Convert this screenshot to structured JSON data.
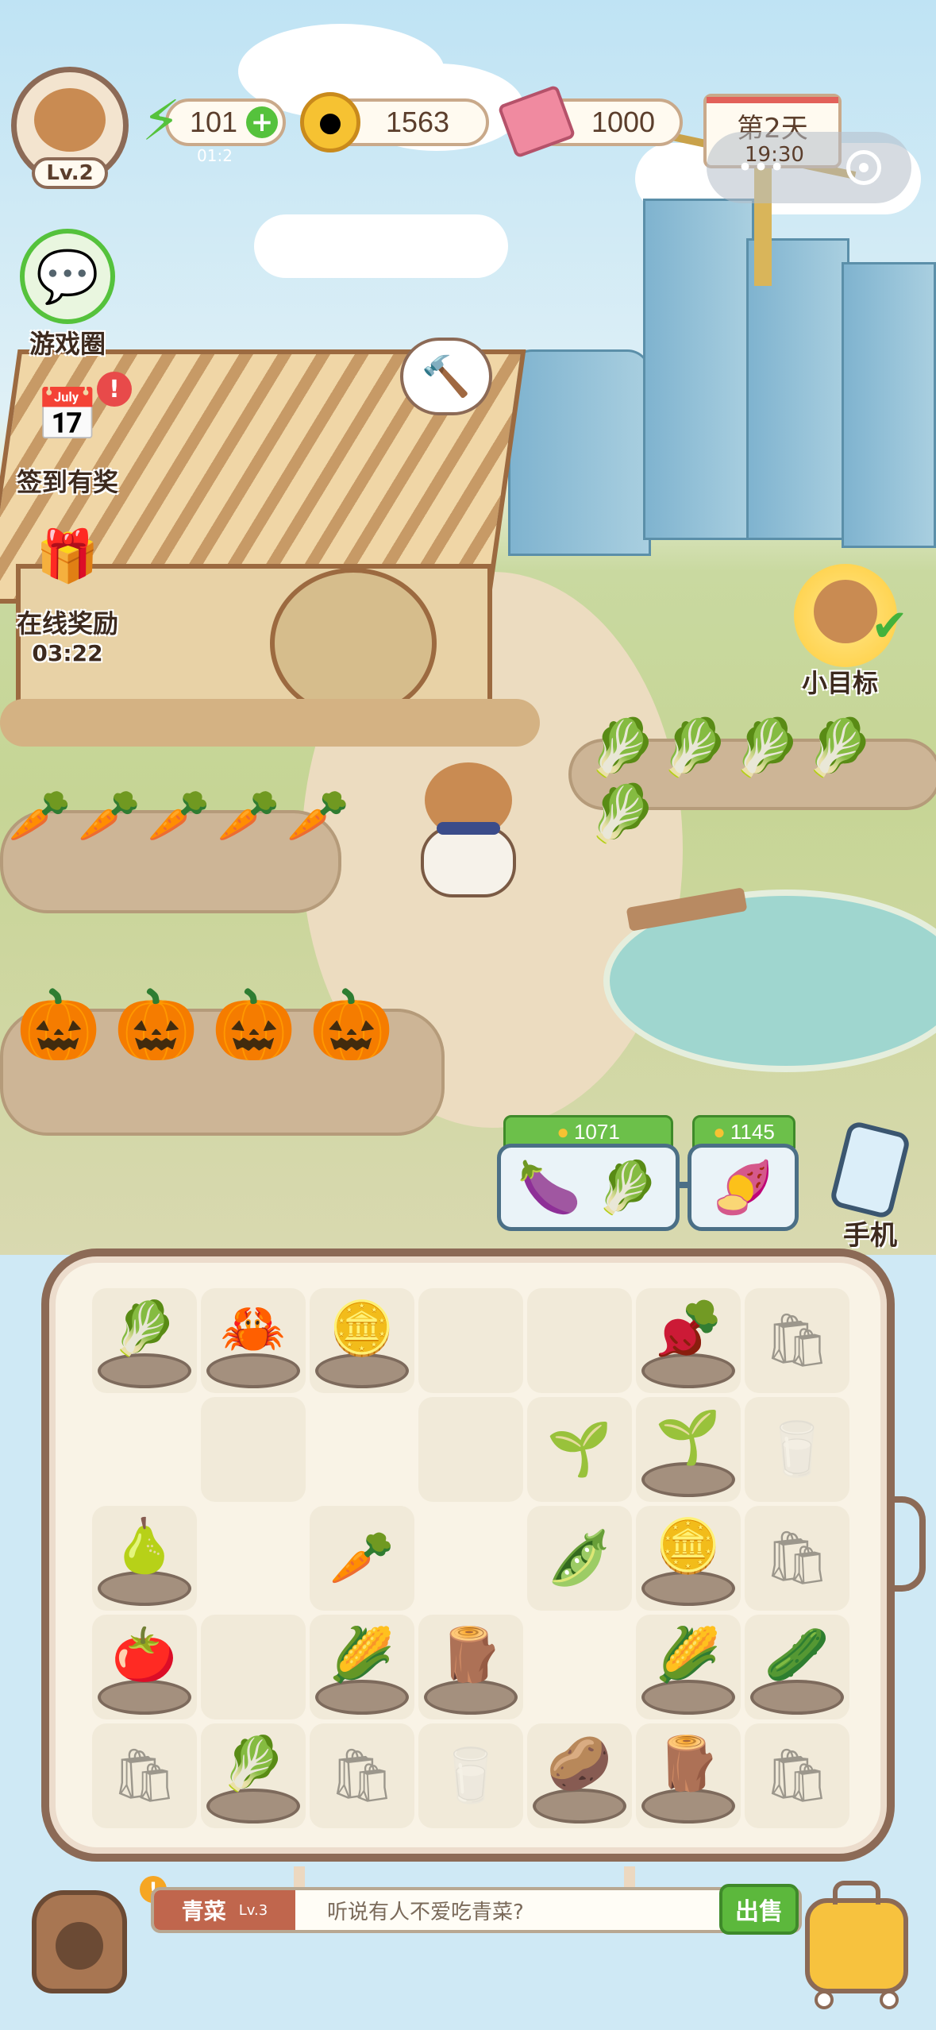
{
  "hud": {
    "level": "Lv.2",
    "energy": "101",
    "energy_timer": "01:2",
    "coins": "1563",
    "cash": "1000",
    "day": "第2天",
    "time": "19:30"
  },
  "side": {
    "game_circle": "游戏圈",
    "checkin": "签到有奖",
    "online_reward": "在线奖励",
    "online_timer": "03:22"
  },
  "goal": {
    "label": "小目标"
  },
  "orders": [
    {
      "price": "1071",
      "items": [
        "eggplant",
        "bok-choy"
      ]
    },
    {
      "price": "1145",
      "items": [
        "sweet-potato"
      ]
    }
  ],
  "phone": {
    "label": "手机"
  },
  "board": {
    "rows": [
      [
        "cabbage",
        "crab",
        "coin",
        "empty",
        "empty",
        "beet",
        "sack-ghost"
      ],
      [
        "none",
        "empty",
        "none",
        "empty",
        "sprout",
        "sprout-nest",
        "carton-ghost"
      ],
      [
        "gourd",
        "none",
        "carrot",
        "none",
        "pea",
        "coin",
        "sack-ghost"
      ],
      [
        "tomato",
        "empty",
        "corn",
        "yam",
        "none",
        "corn",
        "cucumber"
      ],
      [
        "sack-ghost",
        "napa",
        "sack-ghost",
        "carton-ghost",
        "potato",
        "yam",
        "sack-ghost"
      ]
    ],
    "glyphs": {
      "cabbage": "🥬",
      "crab": "🦀",
      "coin": "🪙",
      "beet": "🫜",
      "sack-ghost": "🛍",
      "carton-ghost": "🥛",
      "sprout": "🌱",
      "sprout-nest": "🌱",
      "gourd": "🍐",
      "carrot": "🥕",
      "pea": "🫛",
      "tomato": "🍅",
      "corn": "🌽",
      "yam": "🪵",
      "cucumber": "🥒",
      "napa": "🥬",
      "potato": "🥔",
      "eggplant": "🍆",
      "bok-choy": "🥬",
      "sweet-potato": "🍠"
    }
  },
  "footer": {
    "item_name": "青菜",
    "item_level": "Lv.3",
    "description": "听说有人不爱吃青菜?",
    "sell_label": "出售"
  },
  "colors": {
    "accent_green": "#6cc04a",
    "board_border": "#8c6a56",
    "sell_green": "#5cb83c"
  }
}
